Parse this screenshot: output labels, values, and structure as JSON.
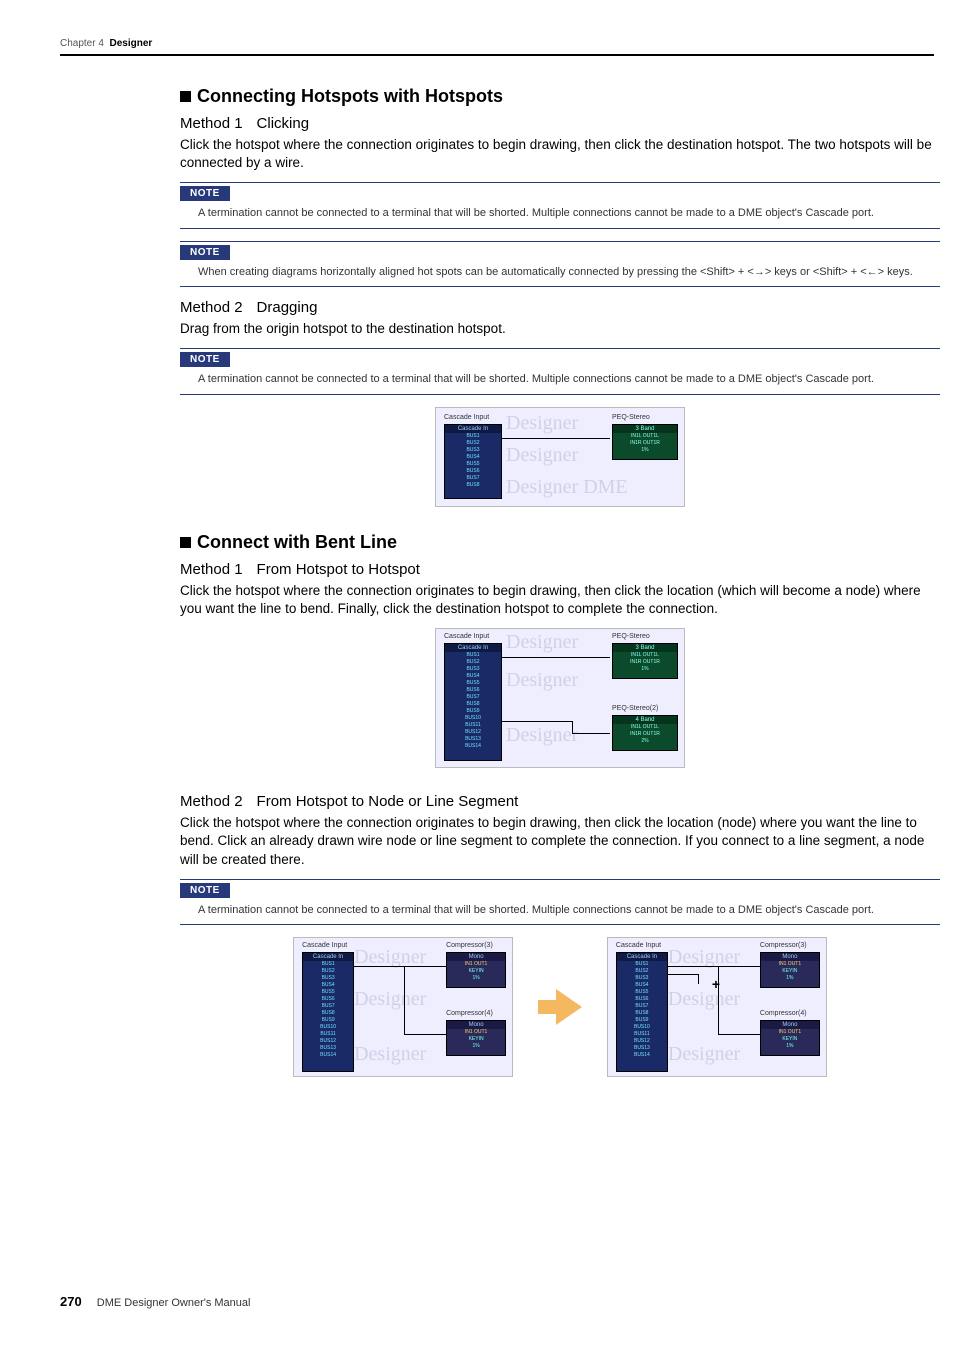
{
  "header": {
    "chapter": "Chapter 4",
    "title": "Designer"
  },
  "section1": {
    "title": "Connecting Hotspots with Hotspots",
    "m1_title_a": "Method 1",
    "m1_title_b": "Clicking",
    "m1_body": "Click the hotspot where the connection originates to begin drawing, then click the destination hotspot. The two hotspots will be connected by a wire.",
    "note1": "A termination cannot be connected to a terminal that will be shorted. Multiple connections cannot be made to a DME object's Cascade port.",
    "note2": "When creating diagrams horizontally aligned hot spots can be automatically connected by pressing the <Shift> + <→> keys or <Shift> + <←> keys.",
    "m2_title_a": "Method 2",
    "m2_title_b": "Dragging",
    "m2_body": "Drag from the origin hotspot to the destination hotspot.",
    "note3": "A termination cannot be connected to a terminal that will be shorted. Multiple connections cannot be made to a DME object's Cascade port."
  },
  "fig1": {
    "cascade_label": "Cascade Input",
    "cascade_hdr": "Cascade In",
    "buses": [
      "BUS1",
      "BUS2",
      "BUS3",
      "BUS4",
      "BUS5",
      "BUS6",
      "BUS7",
      "BUS8"
    ],
    "peq_label": "PEQ-Stereo",
    "peq_hdr": "3 Band",
    "peq_rows": [
      "IN1L  OUT1L",
      "IN1R  OUT1R",
      "1%"
    ],
    "wm1": "Designer",
    "wm2": "Designer",
    "wm3": "Designer  DME"
  },
  "section2": {
    "title": "Connect with Bent Line",
    "m1_title_a": "Method 1",
    "m1_title_b": "From Hotspot to Hotspot",
    "m1_body": "Click the hotspot where the connection originates to begin drawing, then click the location (which will become a node) where you want the line to bend. Finally, click the destination hotspot to complete the connection.",
    "m2_title_a": "Method 2",
    "m2_title_b": "From Hotspot to Node or Line Segment",
    "m2_body": "Click the hotspot where the connection originates to begin drawing, then click the location (node) where you want the line to bend. Click an already drawn wire node or line segment to complete the connection. If you connect to a line segment, a node will be created there.",
    "note4": "A termination cannot be connected to a terminal that will be shorted. Multiple connections cannot be made to a DME object's Cascade port."
  },
  "fig2": {
    "cascade_label": "Cascade Input",
    "cascade_hdr": "Cascade In",
    "buses": [
      "BUS1",
      "BUS2",
      "BUS3",
      "BUS4",
      "BUS5",
      "BUS6",
      "BUS7",
      "BUS8",
      "BUS9",
      "BUS10",
      "BUS11",
      "BUS12",
      "BUS13",
      "BUS14"
    ],
    "peq1_label": "PEQ-Stereo",
    "peq1_hdr": "3 Band",
    "peq1_rows": [
      "IN1L  OUT1L",
      "IN1R  OUT1R",
      "1%"
    ],
    "peq2_label": "PEQ-Stereo(2)",
    "peq2_hdr": "4 Band",
    "peq2_rows": [
      "IN1L  OUT1L",
      "IN1R  OUT1R",
      "2%"
    ]
  },
  "fig3": {
    "cascade_label": "Cascade Input",
    "cascade_hdr": "Cascade In",
    "buses": [
      "BUS1",
      "BUS2",
      "BUS3",
      "BUS4",
      "BUS5",
      "BUS6",
      "BUS7",
      "BUS8",
      "BUS9",
      "BUS10",
      "BUS11",
      "BUS12",
      "BUS13",
      "BUS14"
    ],
    "cmp1_label": "Compressor(3)",
    "cmp1_hdr": "Mono",
    "cmp1_rows": [
      "IN1     OUT1",
      "KEYIN",
      "1%"
    ],
    "cmp2_label": "Compressor(4)",
    "cmp2_hdr": "Mono",
    "cmp2_rows": [
      "IN1     OUT1",
      "KEYIN",
      "1%"
    ]
  },
  "labels": {
    "note": "NOTE"
  },
  "footer": {
    "page": "270",
    "text": "DME Designer Owner's Manual"
  }
}
